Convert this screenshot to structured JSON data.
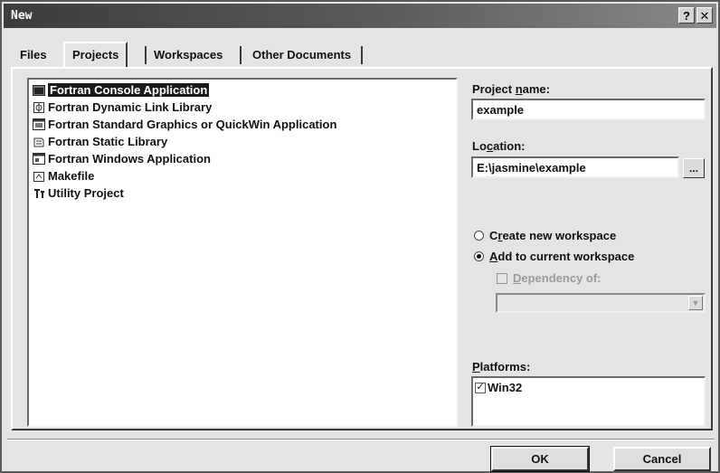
{
  "window": {
    "title": "New",
    "help_glyph": "?",
    "close_glyph": "✕"
  },
  "tabs": [
    {
      "label": "Files"
    },
    {
      "label": "Projects",
      "active": true
    },
    {
      "label": "Workspaces"
    },
    {
      "label": "Other Documents"
    }
  ],
  "project_types": [
    {
      "label": "Fortran Console Application",
      "icon": "console-app-icon",
      "selected": true
    },
    {
      "label": "Fortran Dynamic Link Library",
      "icon": "dll-icon"
    },
    {
      "label": "Fortran Standard Graphics or QuickWin Application",
      "icon": "quickwin-app-icon"
    },
    {
      "label": "Fortran Static Library",
      "icon": "static-library-icon"
    },
    {
      "label": "Fortran Windows Application",
      "icon": "windows-app-icon"
    },
    {
      "label": "Makefile",
      "icon": "makefile-icon"
    },
    {
      "label": "Utility Project",
      "icon": "utility-project-icon"
    }
  ],
  "project_name": {
    "label_pre": "Project ",
    "label_key": "n",
    "label_post": "ame:",
    "value": "example"
  },
  "location": {
    "label_pre": "Lo",
    "label_key": "c",
    "label_post": "ation:",
    "value": "E:\\jasmine\\example",
    "browse_label": "..."
  },
  "workspace_options": [
    {
      "key": "r",
      "pre": "C",
      "post": "eate new workspace",
      "checked": false
    },
    {
      "key": "A",
      "pre": "",
      "post": "dd to current workspace",
      "checked": true
    }
  ],
  "dependency": {
    "key": "D",
    "label_post": "ependency of:",
    "checked": false,
    "enabled": false
  },
  "platforms": {
    "label_key": "P",
    "label_post": "latforms:",
    "items": [
      {
        "label": "Win32",
        "checked": true
      }
    ]
  },
  "buttons": {
    "ok": "OK",
    "cancel": "Cancel"
  },
  "colors": {
    "selection_bg": "#1a1a1a",
    "dialog_bg": "#e4e4e4"
  }
}
